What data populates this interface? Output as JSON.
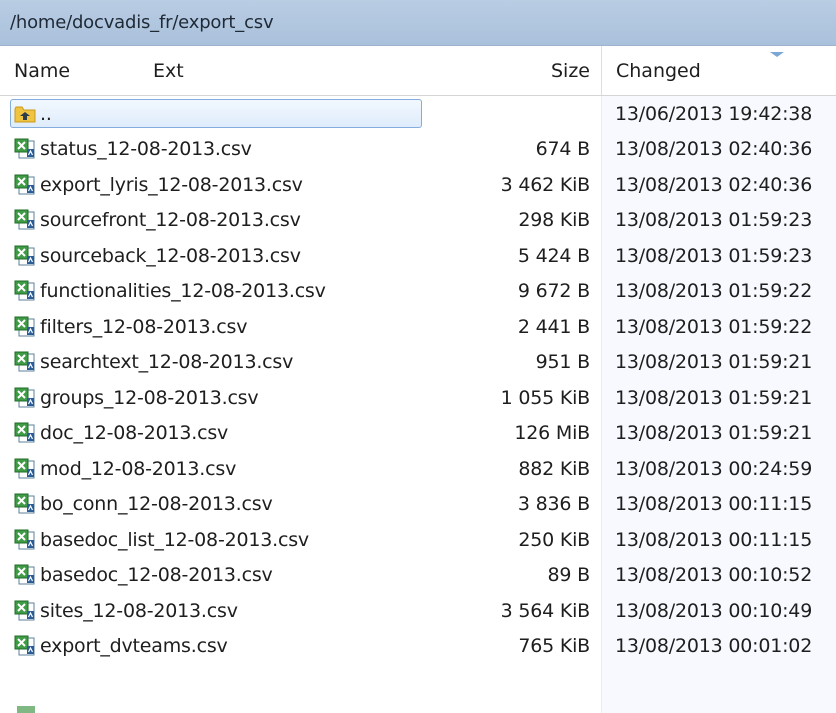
{
  "path": "/home/docvadis_fr/export_csv",
  "columns": {
    "name": "Name",
    "ext": "Ext",
    "size": "Size",
    "changed": "Changed"
  },
  "colors": {
    "path_bar": "#aac1dc",
    "selection_border": "#84acdd",
    "excel_green": "#2e7d32",
    "folder_yellow": "#f0c340"
  },
  "parent_row": {
    "name": "..",
    "changed": "13/06/2013 19:42:38",
    "icon": "parent-folder-icon"
  },
  "files": [
    {
      "name": "status_12-08-2013.csv",
      "size": "674 B",
      "changed": "13/08/2013 02:40:36"
    },
    {
      "name": "export_lyris_12-08-2013.csv",
      "size": "3 462 KiB",
      "changed": "13/08/2013 02:40:36"
    },
    {
      "name": "sourcefront_12-08-2013.csv",
      "size": "298 KiB",
      "changed": "13/08/2013 01:59:23"
    },
    {
      "name": "sourceback_12-08-2013.csv",
      "size": "5 424 B",
      "changed": "13/08/2013 01:59:23"
    },
    {
      "name": "functionalities_12-08-2013.csv",
      "size": "9 672 B",
      "changed": "13/08/2013 01:59:22"
    },
    {
      "name": "filters_12-08-2013.csv",
      "size": "2 441 B",
      "changed": "13/08/2013 01:59:22"
    },
    {
      "name": "searchtext_12-08-2013.csv",
      "size": "951 B",
      "changed": "13/08/2013 01:59:21"
    },
    {
      "name": "groups_12-08-2013.csv",
      "size": "1 055 KiB",
      "changed": "13/08/2013 01:59:21"
    },
    {
      "name": "doc_12-08-2013.csv",
      "size": "126 MiB",
      "changed": "13/08/2013 01:59:21"
    },
    {
      "name": "mod_12-08-2013.csv",
      "size": "882 KiB",
      "changed": "13/08/2013 00:24:59"
    },
    {
      "name": "bo_conn_12-08-2013.csv",
      "size": "3 836 B",
      "changed": "13/08/2013 00:11:15"
    },
    {
      "name": "basedoc_list_12-08-2013.csv",
      "size": "250 KiB",
      "changed": "13/08/2013 00:11:15"
    },
    {
      "name": "basedoc_12-08-2013.csv",
      "size": "89 B",
      "changed": "13/08/2013 00:10:52"
    },
    {
      "name": "sites_12-08-2013.csv",
      "size": "3 564 KiB",
      "changed": "13/08/2013 00:10:49"
    },
    {
      "name": "export_dvteams.csv",
      "size": "765 KiB",
      "changed": "13/08/2013 00:01:02"
    }
  ],
  "file_icon": "excel-csv-file-icon"
}
